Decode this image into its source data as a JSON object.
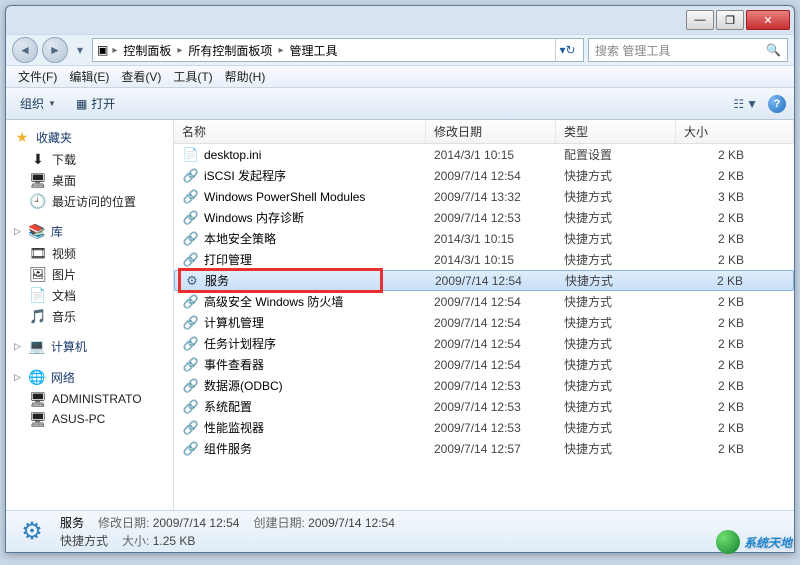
{
  "titlebar": {
    "min": "—",
    "max": "❐",
    "close": "✕"
  },
  "address": {
    "crumbs": [
      "控制面板",
      "所有控制面板项",
      "管理工具"
    ],
    "refresh": "↻",
    "search_placeholder": "搜索 管理工具",
    "search_icon": "🔍"
  },
  "menu": {
    "file": "文件(F)",
    "edit": "编辑(E)",
    "view": "查看(V)",
    "tools": "工具(T)",
    "help": "帮助(H)"
  },
  "toolbar": {
    "organize": "组织",
    "open": "打开",
    "view_icon": "☷",
    "help": "?"
  },
  "sidebar": {
    "favorites": {
      "label": "收藏夹",
      "items": [
        "下载",
        "桌面",
        "最近访问的位置"
      ]
    },
    "libraries": {
      "label": "库",
      "items": [
        "视频",
        "图片",
        "文档",
        "音乐"
      ]
    },
    "computer": {
      "label": "计算机"
    },
    "network": {
      "label": "网络",
      "items": [
        "ADMINISTRATO",
        "ASUS-PC"
      ]
    }
  },
  "columns": {
    "name": "名称",
    "date": "修改日期",
    "type": "类型",
    "size": "大小"
  },
  "files": [
    {
      "name": "desktop.ini",
      "date": "2014/3/1 10:15",
      "type": "配置设置",
      "size": "2 KB",
      "ico": "📄"
    },
    {
      "name": "iSCSI 发起程序",
      "date": "2009/7/14 12:54",
      "type": "快捷方式",
      "size": "2 KB",
      "ico": "🔗"
    },
    {
      "name": "Windows PowerShell Modules",
      "date": "2009/7/14 13:32",
      "type": "快捷方式",
      "size": "3 KB",
      "ico": "🔗"
    },
    {
      "name": "Windows 内存诊断",
      "date": "2009/7/14 12:53",
      "type": "快捷方式",
      "size": "2 KB",
      "ico": "🔗"
    },
    {
      "name": "本地安全策略",
      "date": "2014/3/1 10:15",
      "type": "快捷方式",
      "size": "2 KB",
      "ico": "🔗"
    },
    {
      "name": "打印管理",
      "date": "2014/3/1 10:15",
      "type": "快捷方式",
      "size": "2 KB",
      "ico": "🔗"
    },
    {
      "name": "服务",
      "date": "2009/7/14 12:54",
      "type": "快捷方式",
      "size": "2 KB",
      "ico": "⚙",
      "selected": true
    },
    {
      "name": "高级安全 Windows 防火墙",
      "date": "2009/7/14 12:54",
      "type": "快捷方式",
      "size": "2 KB",
      "ico": "🔗"
    },
    {
      "name": "计算机管理",
      "date": "2009/7/14 12:54",
      "type": "快捷方式",
      "size": "2 KB",
      "ico": "🔗"
    },
    {
      "name": "任务计划程序",
      "date": "2009/7/14 12:54",
      "type": "快捷方式",
      "size": "2 KB",
      "ico": "🔗"
    },
    {
      "name": "事件查看器",
      "date": "2009/7/14 12:54",
      "type": "快捷方式",
      "size": "2 KB",
      "ico": "🔗"
    },
    {
      "name": "数据源(ODBC)",
      "date": "2009/7/14 12:53",
      "type": "快捷方式",
      "size": "2 KB",
      "ico": "🔗"
    },
    {
      "name": "系统配置",
      "date": "2009/7/14 12:53",
      "type": "快捷方式",
      "size": "2 KB",
      "ico": "🔗"
    },
    {
      "name": "性能监视器",
      "date": "2009/7/14 12:53",
      "type": "快捷方式",
      "size": "2 KB",
      "ico": "🔗"
    },
    {
      "name": "组件服务",
      "date": "2009/7/14 12:57",
      "type": "快捷方式",
      "size": "2 KB",
      "ico": "🔗"
    }
  ],
  "status": {
    "name": "服务",
    "mod_label": "修改日期:",
    "mod_val": "2009/7/14 12:54",
    "created_label": "创建日期:",
    "created_val": "2009/7/14 12:54",
    "type_label": "快捷方式",
    "size_label": "大小:",
    "size_val": "1.25 KB"
  },
  "watermark": "系统天地"
}
